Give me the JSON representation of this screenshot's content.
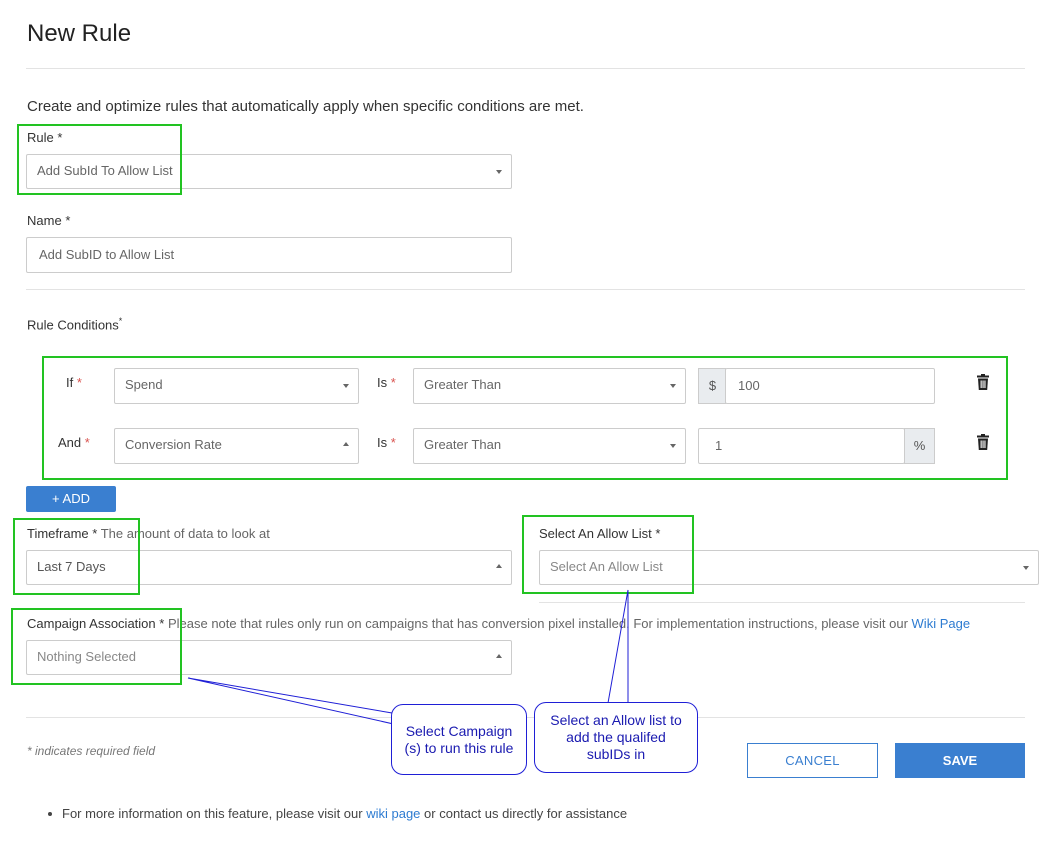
{
  "page": {
    "title": "New Rule",
    "description": "Create and optimize rules that automatically apply when specific conditions are met."
  },
  "rule": {
    "label": "Rule",
    "req": "*",
    "value": "Add SubId To Allow List"
  },
  "name": {
    "label": "Name",
    "req": "*",
    "placeholder": "Add SubID to Allow List"
  },
  "conditions": {
    "label": "Rule Conditions",
    "req": "*",
    "rows": [
      {
        "prefix": "If",
        "req": "*",
        "metric": "Spend",
        "is_label": "Is",
        "is_req": "*",
        "operator": "Greater Than",
        "addon": "$",
        "value": "100"
      },
      {
        "prefix": "And",
        "req": "*",
        "metric": "Conversion Rate",
        "is_label": "Is",
        "is_req": "*",
        "operator": "Greater Than",
        "addon": "%",
        "value": "1"
      }
    ],
    "add_button": "+ ADD"
  },
  "timeframe": {
    "label": "Timeframe",
    "req": "*",
    "hint": "The amount of data to look at",
    "value": "Last 7 Days"
  },
  "allow_list": {
    "label": "Select An Allow List",
    "req": "*",
    "value": "Select An Allow List"
  },
  "campaign": {
    "label": "Campaign Association",
    "req": "*",
    "note": "Please note that rules only run on campaigns that has conversion pixel installed. For implementation instructions, please visit our",
    "link": "Wiki Page",
    "value": "Nothing Selected"
  },
  "footer": {
    "required_note": "* indicates required field",
    "cancel": "CANCEL",
    "save": "SAVE",
    "info_prefix": "For more information on this feature, please visit our",
    "info_link": "wiki page",
    "info_suffix": "or contact us directly for assistance"
  },
  "annotations": {
    "campaign_callout": "Select Campaign (s) to run this rule",
    "allowlist_callout": "Select an Allow list to add the qualifed subIDs in"
  },
  "colors": {
    "primary": "#3a7fd0",
    "highlight": "#22c322",
    "callout": "#1f1fd6",
    "required": "#d9534f"
  },
  "icons": {
    "caret": "caret-down-icon",
    "trash": "trash-icon",
    "bullet": "bullet-icon"
  }
}
